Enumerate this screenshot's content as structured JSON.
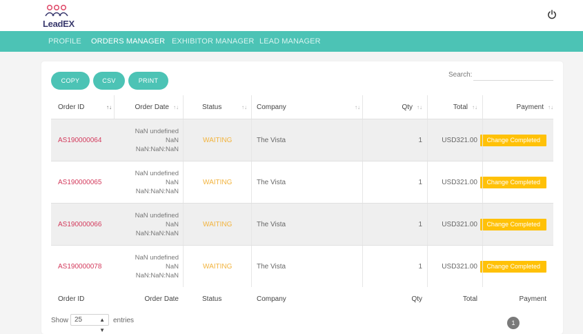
{
  "brand": {
    "logo_text": "LeadEX"
  },
  "nav": {
    "items": [
      {
        "label": "PROFILE"
      },
      {
        "label": "ORDERS MANAGER"
      },
      {
        "label": "EXHIBITOR MANAGER"
      },
      {
        "label": "LEAD MANAGER"
      }
    ],
    "active_index": 1
  },
  "toolbar": {
    "copy_label": "COPY",
    "csv_label": "CSV",
    "print_label": "PRINT"
  },
  "search": {
    "label": "Search:",
    "value": ""
  },
  "table": {
    "columns": [
      "Order ID",
      "Order Date",
      "Status",
      "Company",
      "Qty",
      "Total",
      "Payment"
    ],
    "rows": [
      {
        "order_id": "AS190000064",
        "date_line1": "NaN undefined",
        "date_line2": "NaN",
        "date_line3": "NaN:NaN:NaN",
        "status": "WAITING",
        "company": "The Vista",
        "qty": "1",
        "total": "USD321.00",
        "payment": "Change Completed"
      },
      {
        "order_id": "AS190000065",
        "date_line1": "NaN undefined",
        "date_line2": "NaN",
        "date_line3": "NaN:NaN:NaN",
        "status": "WAITING",
        "company": "The Vista",
        "qty": "1",
        "total": "USD321.00",
        "payment": "Change Completed"
      },
      {
        "order_id": "AS190000066",
        "date_line1": "NaN undefined",
        "date_line2": "NaN",
        "date_line3": "NaN:NaN:NaN",
        "status": "WAITING",
        "company": "The Vista",
        "qty": "1",
        "total": "USD321.00",
        "payment": "Change Completed"
      },
      {
        "order_id": "AS190000078",
        "date_line1": "NaN undefined",
        "date_line2": "NaN",
        "date_line3": "NaN:NaN:NaN",
        "status": "WAITING",
        "company": "The Vista",
        "qty": "1",
        "total": "USD321.00",
        "payment": "Change Completed"
      }
    ],
    "footer": [
      "Order ID",
      "Order Date",
      "Status",
      "Company",
      "Qty",
      "Total",
      "Payment"
    ]
  },
  "pagination": {
    "show_label": "Show",
    "page_size": "25",
    "entries_label": "entries",
    "current_page": "1"
  },
  "colors": {
    "accent": "#4cc3b5",
    "order_id": "#d33a5c",
    "status": "#f2b33d",
    "payment_button": "#ffc107"
  },
  "icons": {
    "power": "power-icon",
    "sort": "sort-arrows-icon",
    "select_caret": "select-caret-icon",
    "logo": "people-group-icon"
  }
}
